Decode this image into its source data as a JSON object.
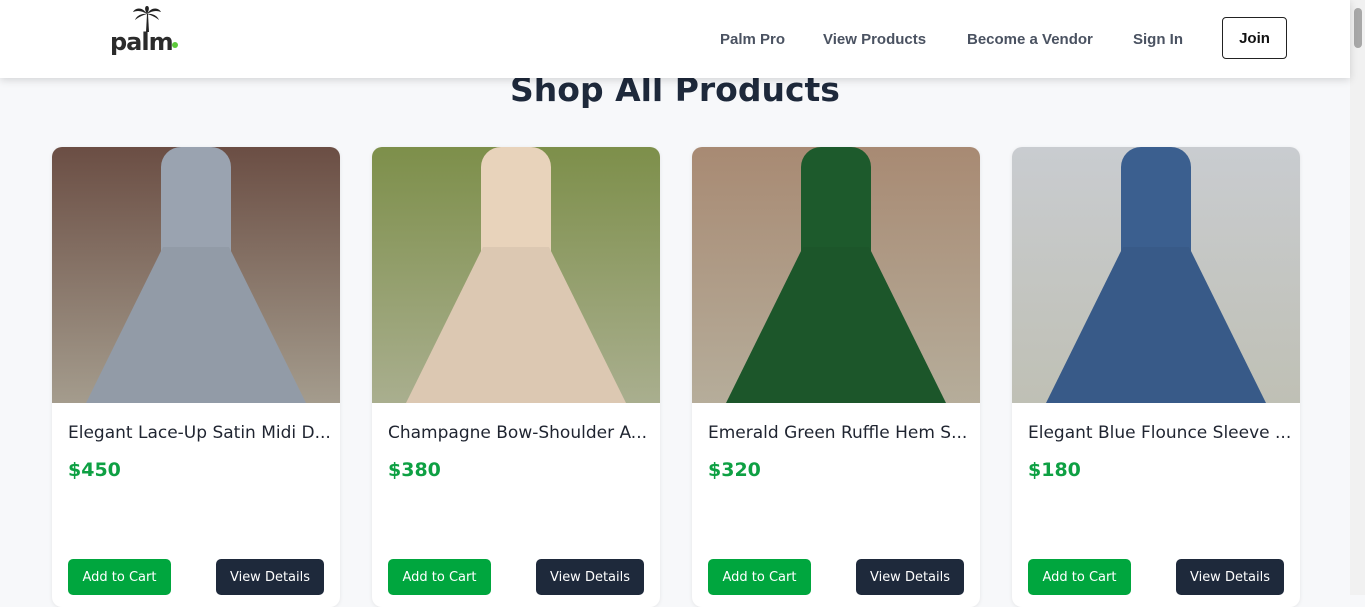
{
  "header": {
    "logo_text": "palm",
    "nav": [
      "Palm Pro",
      "View Products",
      "Become a Vendor",
      "Sign In"
    ],
    "join_label": "Join"
  },
  "page_title": "Shop All Products",
  "products": [
    {
      "title": "Elegant Lace-Up Satin Midi D...",
      "price": "$450",
      "add_label": "Add to Cart",
      "view_label": "View Details",
      "bg": "#6b4e44",
      "dress": "#9aa3b0"
    },
    {
      "title": "Champagne Bow-Shoulder A...",
      "price": "$380",
      "add_label": "Add to Cart",
      "view_label": "View Details",
      "bg": "#7d8f4a",
      "dress": "#e8d3bb"
    },
    {
      "title": "Emerald Green Ruffle Hem S...",
      "price": "$320",
      "add_label": "Add to Cart",
      "view_label": "View Details",
      "bg": "#a88a73",
      "dress": "#1d5a2c"
    },
    {
      "title": "Elegant Blue Flounce Sleeve ...",
      "price": "$180",
      "add_label": "Add to Cart",
      "view_label": "View Details",
      "bg": "#c9ccd0",
      "dress": "#3b5f8f"
    }
  ]
}
